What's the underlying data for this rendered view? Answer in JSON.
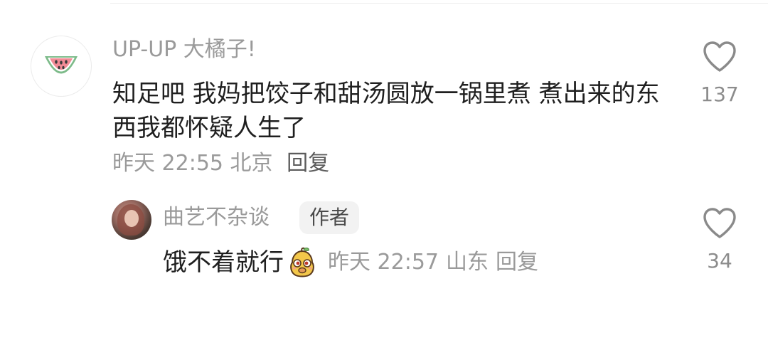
{
  "comment": {
    "username": "UP-UP 大橘子!",
    "avatar_icon": "watermelon-icon",
    "content": "知足吧  我妈把饺子和甜汤圆放一锅里煮 煮出来的东西我都怀疑人生了",
    "time": "昨天 22:55",
    "location": "北京",
    "reply_label": "回复",
    "likes": "137"
  },
  "reply": {
    "username": "曲艺不杂谈",
    "badge": "作者",
    "content": "饿不着就行",
    "emoji_icon": "pear-face-emoji-icon",
    "time": "昨天 22:57",
    "location": "山东",
    "reply_label": "回复",
    "likes": "34"
  },
  "colors": {
    "secondary_text": "#9a9a9a",
    "primary_text": "#1f1f1f",
    "badge_bg": "#f2f2f2"
  }
}
